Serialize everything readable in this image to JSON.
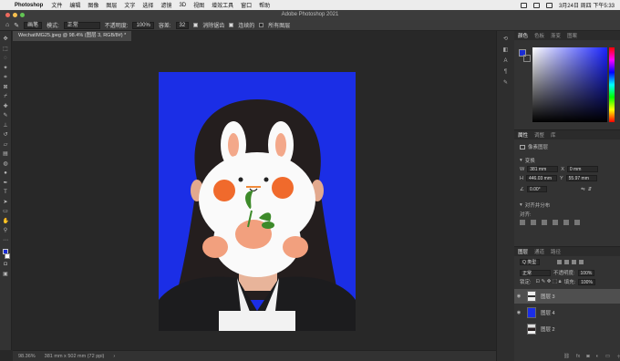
{
  "menubar": {
    "apple": "",
    "app_name": "Photoshop",
    "items": [
      "文件",
      "编辑",
      "图像",
      "图层",
      "文字",
      "选择",
      "滤镜",
      "3D",
      "视图",
      "增效工具",
      "窗口",
      "帮助"
    ],
    "clock": "3月24日 周四 下午5:33"
  },
  "titlebar": {
    "title": "Adobe Photoshop 2021"
  },
  "options": {
    "tool_preset": "画笔",
    "mode_label": "模式:",
    "mode_value": "正常",
    "opacity_label": "不透明度:",
    "opacity_value": "100%",
    "tolerance_label": "容差:",
    "tolerance_value": "32",
    "antialias_label": "消除锯齿",
    "contiguous_label": "连续的",
    "all_layers_label": "所有图层"
  },
  "document": {
    "tab_title": "WechatIMG25.jpeg @ 98.4% (图层 3, RGB/8#) *"
  },
  "status": {
    "zoom": "98.36%",
    "doc_info": "381 mm x 502 mm (72 ppi)"
  },
  "color_panel": {
    "tabs": [
      "颜色",
      "色板",
      "渐变",
      "图案"
    ],
    "foreground": "#1b2dd4",
    "background": "#ffffff"
  },
  "properties": {
    "tabs": [
      "属性",
      "调整",
      "库"
    ],
    "layer_type": "像素图层",
    "transform_label": "变换",
    "w_label": "W",
    "w_value": "381 mm",
    "x_label": "X",
    "x_value": "0 mm",
    "h_label": "H",
    "h_value": "446.03 mm",
    "y_label": "Y",
    "y_value": "55.97 mm",
    "angle_value": "0.00°",
    "align_label": "对齐并分布",
    "align_sub": "对齐:"
  },
  "layers_panel": {
    "tabs": [
      "图层",
      "通道",
      "路径"
    ],
    "kind_label": "Q 类型",
    "blend_mode": "正常",
    "opacity_label": "不透明度:",
    "opacity_value": "100%",
    "lock_label": "锁定:",
    "fill_label": "填充:",
    "fill_value": "100%",
    "layers": [
      {
        "name": "图层 3",
        "selected": true
      },
      {
        "name": "图层 4",
        "selected": false
      },
      {
        "name": "图层 2",
        "selected": false
      }
    ]
  },
  "colors": {
    "photo_bg": "#1b2ee6"
  }
}
